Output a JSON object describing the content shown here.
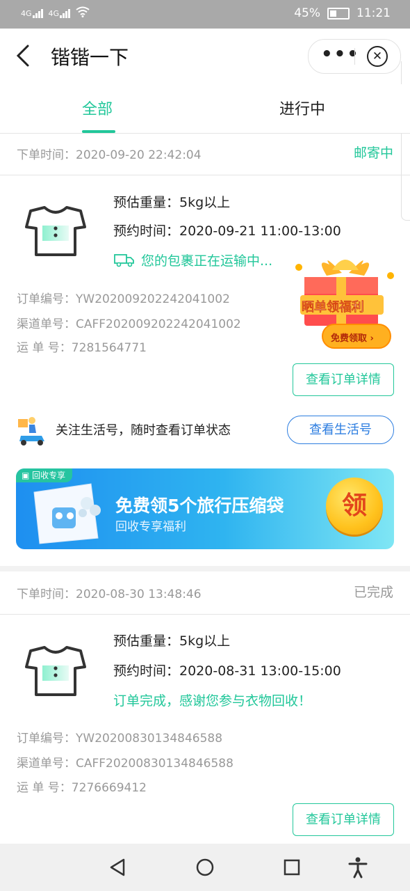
{
  "status_bar": {
    "signal_left_1": "4G",
    "signal_left_2": "4G",
    "battery": "45%",
    "time": "11:21"
  },
  "nav": {
    "title": "锴锴一下",
    "more_label": "•••"
  },
  "tabs": [
    {
      "label": "全部",
      "active": true
    },
    {
      "label": "进行中",
      "active": false
    }
  ],
  "orders": [
    {
      "time_label": "下单时间：2020-09-20 22:42:04",
      "status": "邮寄中",
      "status_color": "#22c79a",
      "weight": "预估重量：5kg以上",
      "appointment": "预约时间：2020-09-21 11:00-13:00",
      "message": "您的包裹正在运输中...",
      "order_no": "订单编号：YW202009202242041002",
      "channel_no": "渠道单号：CAFF202009202242041002",
      "waybill_no": "运 单 号：7281564771",
      "detail_button": "查看订单详情"
    },
    {
      "time_label": "下单时间：2020-08-30 13:48:46",
      "status": "已完成",
      "status_color": "#999999",
      "weight": "预估重量：5kg以上",
      "appointment": "预约时间：2020-08-31 13:00-15:00",
      "message": "订单完成，感谢您参与衣物回收！",
      "order_no": "订单编号：YW20200830134846588",
      "channel_no": "渠道单号：CAFF20200830134846588",
      "waybill_no": "运 单 号：7276669412",
      "detail_button": "查看订单详情"
    }
  ],
  "gift": {
    "title": "晒单领福利",
    "button": "免费领取 ›"
  },
  "follow": {
    "text": "关注生活号，随时查看订单状态",
    "button": "查看生活号"
  },
  "banner": {
    "tag": "回收专享",
    "title": "免费领5个旅行压缩袋",
    "subtitle": "回收专享福利",
    "coin": "领"
  },
  "colors": {
    "accent": "#22c79a",
    "link_blue": "#2c7de0"
  }
}
